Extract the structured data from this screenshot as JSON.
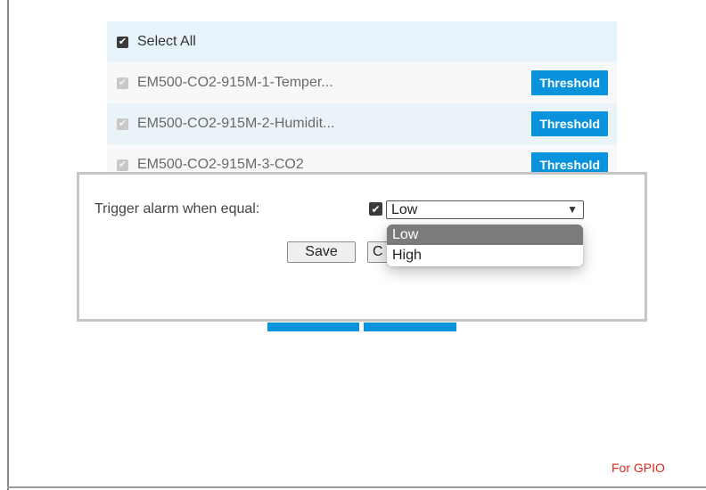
{
  "list": {
    "select_all_label": "Select All",
    "items": [
      {
        "name": "EM500-CO2-915M-1-Temper...",
        "button": "Threshold"
      },
      {
        "name": "EM500-CO2-915M-2-Humidit...",
        "button": "Threshold"
      },
      {
        "name": "EM500-CO2-915M-3-CO2",
        "button": "Threshold"
      }
    ]
  },
  "dialog": {
    "trigger_label": "Trigger alarm when equal:",
    "selected_value": "Low",
    "options": [
      "Low",
      "High"
    ],
    "save_label": "Save",
    "cancel_label": "C"
  },
  "footer": {
    "gpio_text": "For GPIO"
  },
  "colors": {
    "accent": "#0a93dd",
    "gpio": "#e0281c"
  }
}
